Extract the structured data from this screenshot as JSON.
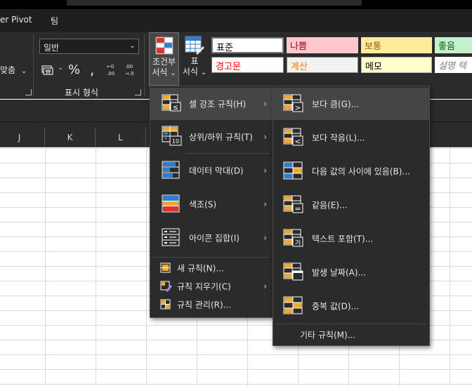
{
  "title_bar": {},
  "tabs": [
    {
      "label": "er Pivot"
    },
    {
      "label": "팀"
    }
  ],
  "number_group": {
    "format_value": "일반",
    "currency_symbol": "₩",
    "percent_symbol": "%",
    "comma_symbol": ",",
    "label": "표시 형식"
  },
  "alignment_group": {
    "merge_partial_label": "맞춤"
  },
  "styles_group": {
    "conditional_formatting": {
      "line1": "조건부",
      "line2": "서식"
    },
    "format_as_table": {
      "line1": "표",
      "line2": "서식"
    },
    "cell_styles": [
      {
        "label": "표준",
        "bg": "#ffffff",
        "fg": "#000000"
      },
      {
        "label": "나쁨",
        "bg": "#ffc7ce",
        "fg": "#9c0006"
      },
      {
        "label": "보통",
        "bg": "#ffeb9c",
        "fg": "#9c5700"
      },
      {
        "label": "좋음",
        "bg": "#c6efce",
        "fg": "#006100"
      },
      {
        "label": "경고문",
        "bg": "#ffffff",
        "fg": "#ff0000"
      },
      {
        "label": "계산",
        "bg": "#f2f2f2",
        "fg": "#fa7d00"
      },
      {
        "label": "메모",
        "bg": "#ffffcc",
        "fg": "#000000"
      },
      {
        "label": "설명 텍",
        "bg": "#ffffff",
        "fg": "#7f7f7f"
      }
    ]
  },
  "columns": [
    "J",
    "K",
    "L"
  ],
  "conditional_menu": {
    "items": [
      {
        "label": "셀 강조 규칙(H)",
        "has_submenu": true
      },
      {
        "label": "상위/하위 규칙(T)",
        "has_submenu": true
      },
      {
        "label": "데이터 막대(D)",
        "has_submenu": true
      },
      {
        "label": "색조(S)",
        "has_submenu": true
      },
      {
        "label": "아이콘 집합(I)",
        "has_submenu": true
      }
    ],
    "small_items": [
      {
        "label": "새 규칙(N)...",
        "has_submenu": false
      },
      {
        "label": "규칙 지우기(C)",
        "has_submenu": true
      },
      {
        "label": "규칙 관리(R)...",
        "has_submenu": false
      }
    ]
  },
  "highlight_submenu": {
    "items": [
      {
        "label": "보다 큼(G)..."
      },
      {
        "label": "보다 작음(L)..."
      },
      {
        "label": "다음 값의 사이에 있음(B)..."
      },
      {
        "label": "같음(E)..."
      },
      {
        "label": "텍스트 포함(T)..."
      },
      {
        "label": "발생 날짜(A)..."
      },
      {
        "label": "중복 값(D)..."
      }
    ],
    "more_rules": "기타 규칙(M)...",
    "sub_glyphs": [
      ">",
      "<",
      "=",
      "가"
    ]
  },
  "icon_colors": {
    "orange": "#f0a830",
    "blue": "#2d7fd0",
    "red": "#e03030",
    "grid": "#ffffff"
  }
}
